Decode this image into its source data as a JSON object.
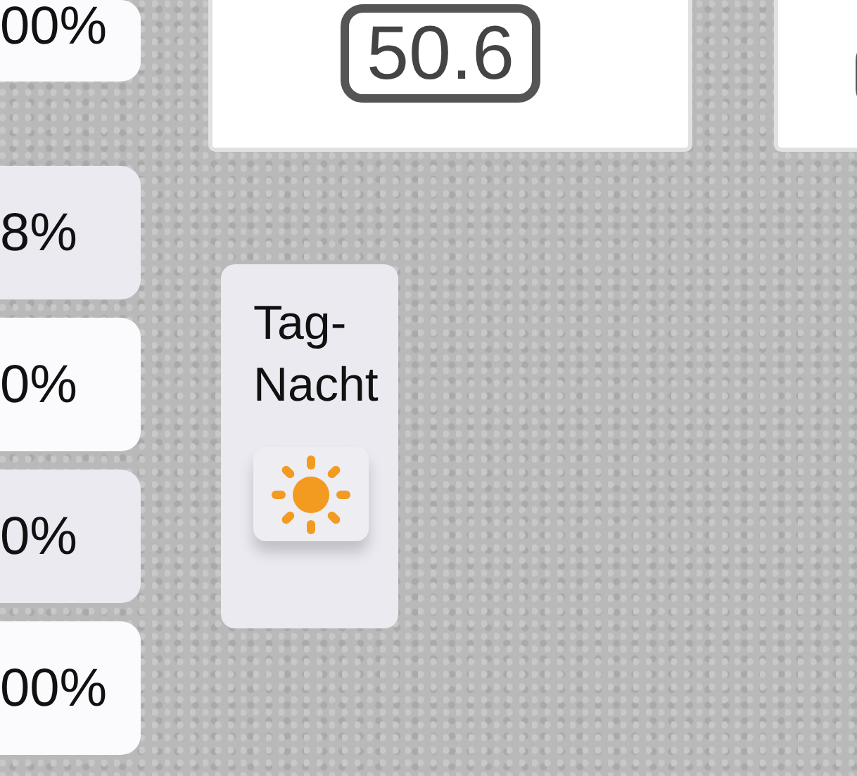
{
  "left_tiles": [
    {
      "value": "00%",
      "color": "#fbfbfd"
    },
    {
      "value": "8%",
      "color": "#ebeaf1"
    },
    {
      "value": "0%",
      "color": "#fbfbfd"
    },
    {
      "value": "0%",
      "color": "#ebeaf1"
    },
    {
      "value": "00%",
      "color": "#fbfbfd"
    }
  ],
  "value_panel": {
    "value": "50.6"
  },
  "day_night": {
    "label": "Tag-Nacht",
    "is_day": true
  }
}
